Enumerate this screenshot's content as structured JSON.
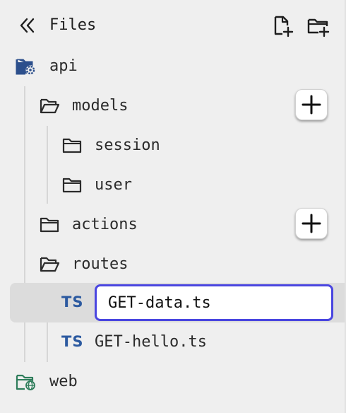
{
  "header": {
    "title": "Files"
  },
  "icons": {
    "collapse": "double-chevron-left-icon",
    "new_file": "new-file-icon",
    "new_folder": "new-folder-icon",
    "api_folder": "folder-settings-icon",
    "web_folder": "folder-globe-icon",
    "folder_open": "folder-open-icon",
    "folder_closed": "folder-icon",
    "add": "plus-icon"
  },
  "tree": {
    "api": {
      "label": "api"
    },
    "models": {
      "label": "models"
    },
    "session": {
      "label": "session"
    },
    "user": {
      "label": "user"
    },
    "actions": {
      "label": "actions"
    },
    "routes": {
      "label": "routes"
    },
    "file_editing": {
      "badge": "TS",
      "value": "GET-data.ts"
    },
    "file_hello": {
      "badge": "TS",
      "label": "GET-hello.ts"
    },
    "web": {
      "label": "web"
    }
  },
  "colors": {
    "panel_bg": "#efefef",
    "selected_bg": "#dcdcdc",
    "edit_border": "#4a46e0",
    "ts_badge": "#2c5aa0",
    "api_icon": "#2c4f8c",
    "web_icon": "#2e7d5b"
  }
}
